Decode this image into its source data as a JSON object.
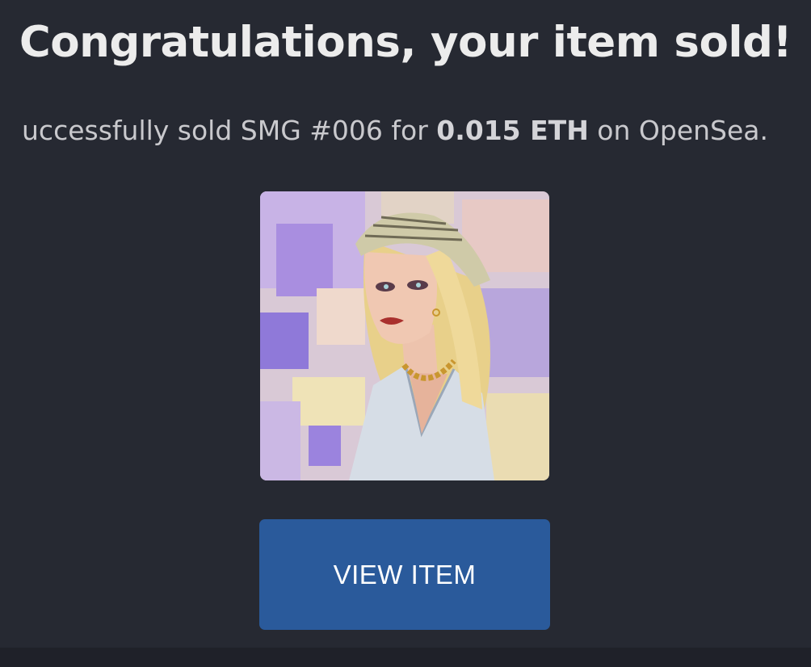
{
  "header": {
    "title": "Congratulations, your item sold!"
  },
  "message": {
    "prefix": "uccessfully sold SMG #006 for ",
    "amount": "0.015 ETH",
    "suffix": " on OpenSea."
  },
  "artwork": {
    "icon": "nft-portrait-woman-headscarf"
  },
  "actions": {
    "view_item_label": "VIEW ITEM"
  },
  "colors": {
    "background": "#262932",
    "button": "#2a5a9b",
    "title": "#ececec"
  }
}
